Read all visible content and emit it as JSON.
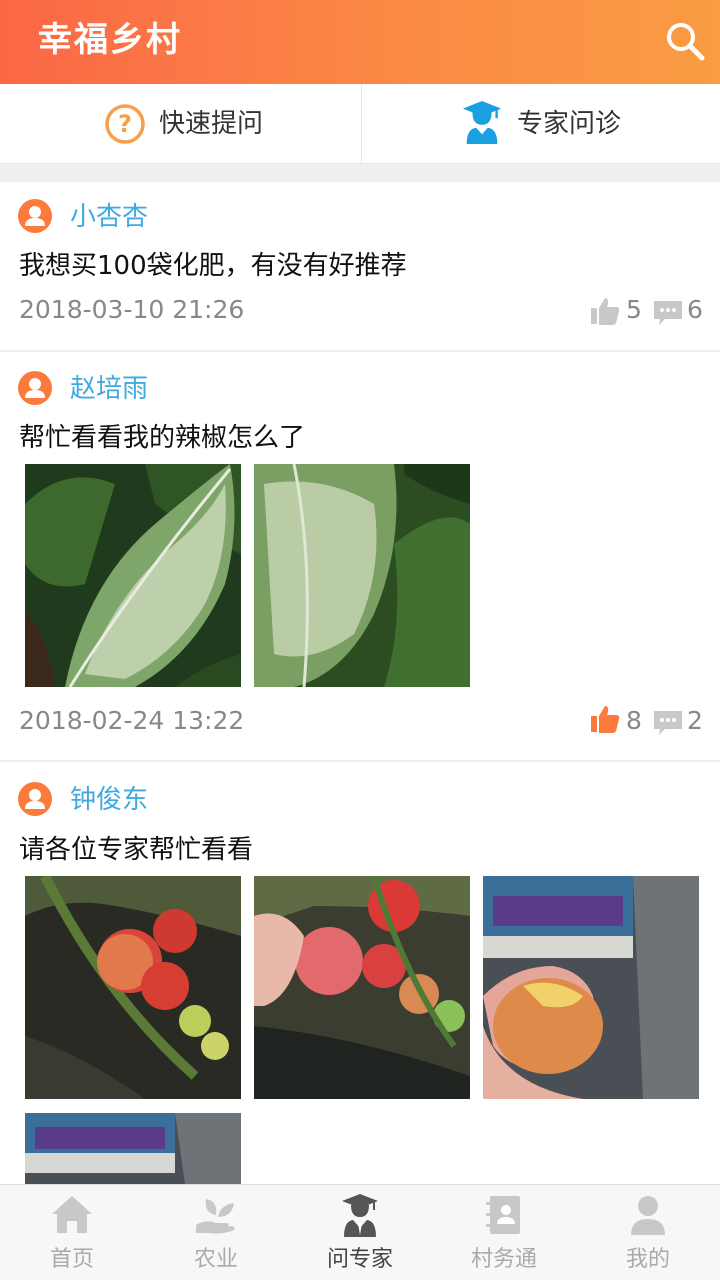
{
  "header": {
    "title": "幸福乡村",
    "search_icon": "search-icon"
  },
  "actions": {
    "ask": {
      "label": "快速提问",
      "icon": "question-circle-icon"
    },
    "expert": {
      "label": "专家问诊",
      "icon": "doctor-expert-icon"
    }
  },
  "posts": [
    {
      "author": "小杏杏",
      "text": "我想买100袋化肥，有没有好推荐",
      "time": "2018-03-10 21:26",
      "likes": "5",
      "comments": "6",
      "liked": false,
      "photo_count": 0
    },
    {
      "author": "赵培雨",
      "text": "帮忙看看我的辣椒怎么了",
      "time": "2018-02-24 13:22",
      "likes": "8",
      "comments": "2",
      "liked": true,
      "photo_count": 2
    },
    {
      "author": "钟俊东",
      "text": "请各位专家帮忙看看",
      "photo_count": 4
    }
  ],
  "colors": {
    "header_start": "#fb6746",
    "header_end": "#f99c43",
    "author": "#3fa9e0",
    "like_active": "#fb7a3c",
    "icon_grey": "#c8c8c8"
  },
  "tabbar": {
    "items": [
      {
        "label": "首页",
        "icon": "home-icon",
        "active": false
      },
      {
        "label": "农业",
        "icon": "plant-hand-icon",
        "active": false
      },
      {
        "label": "问专家",
        "icon": "graduate-expert-icon",
        "active": true
      },
      {
        "label": "村务通",
        "icon": "contacts-book-icon",
        "active": false
      },
      {
        "label": "我的",
        "icon": "user-icon",
        "active": false
      }
    ]
  }
}
